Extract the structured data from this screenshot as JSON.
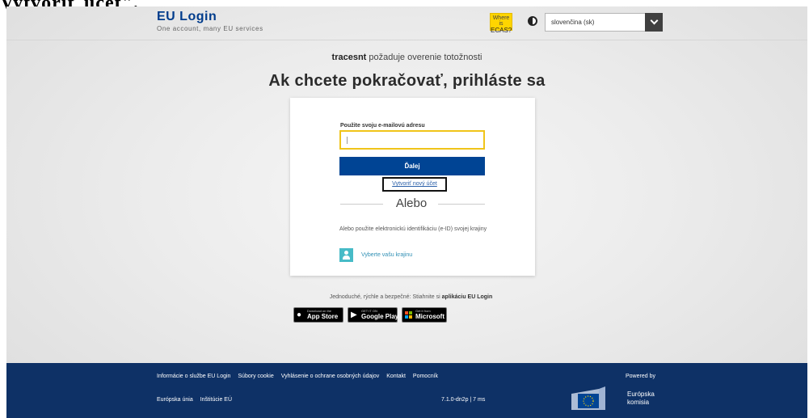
{
  "caption": "Vytvoriť účet\".",
  "header": {
    "title": "EU Login",
    "subtitle": "One account, many EU services",
    "ecas_small": "Where is",
    "ecas_big": "ECAS?",
    "language": "slovenčina (sk)"
  },
  "main": {
    "requester": "tracesnt",
    "request_text": " požaduje overenie totožnosti",
    "heading": "Ak chcete pokračovať, prihláste sa"
  },
  "login": {
    "email_label": "Použite svoju e-mailovú adresu",
    "email_value": "",
    "next_label": "Ďalej",
    "create_account": "Vytvoriť nový účet",
    "or": "Alebo",
    "eid_text": "Alebo použite elektronickú identifikáciu (e-ID) svojej krajiny",
    "country_label": "Vyberte vašu krajinu"
  },
  "promo": {
    "text": "Jednoduché, rýchle a bezpečné: Stiahnite si ",
    "app": "aplikáciu EU Login"
  },
  "stores": [
    {
      "small": "Download on the",
      "big": "App Store",
      "icon": "apple-icon"
    },
    {
      "small": "GET IT ON",
      "big": "Google Play",
      "icon": "google-play-icon"
    },
    {
      "small": "Get it from",
      "big": "Microsoft",
      "icon": "microsoft-icon"
    }
  ],
  "footer": {
    "links": [
      "Informácie o službe EU Login",
      "Súbory cookie",
      "Vyhlásenie o ochrane osobných údajov",
      "Kontakt",
      "Pomocník"
    ],
    "links2": [
      "Európska únia",
      "Inštitúcie EÚ"
    ],
    "version": "7.1.0-dn2p | 7 ms",
    "powered": "Powered by",
    "ec_name_1": "Európska",
    "ec_name_2": "komisia"
  },
  "colors": {
    "brand_blue": "#004494",
    "footer_blue": "#0e3166",
    "ecas_yellow": "#ffd500",
    "input_border": "#f0c419",
    "country_icon": "#47bbc7"
  }
}
